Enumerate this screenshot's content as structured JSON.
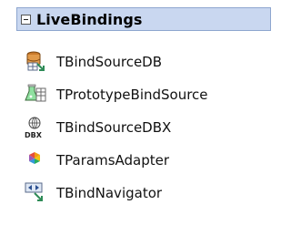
{
  "category": {
    "title": "LiveBindings",
    "state": "expanded"
  },
  "items": [
    {
      "label": "TBindSourceDB",
      "icon": "bind-source-db-icon"
    },
    {
      "label": "TPrototypeBindSource",
      "icon": "prototype-bind-source-icon"
    },
    {
      "label": "TBindSourceDBX",
      "icon": "bind-source-dbx-icon",
      "icon_text": "DBX"
    },
    {
      "label": "TParamsAdapter",
      "icon": "params-adapter-icon"
    },
    {
      "label": "TBindNavigator",
      "icon": "bind-navigator-icon"
    }
  ],
  "colors": {
    "header_bg": "#c9d7f0",
    "header_border": "#8ea6cf",
    "link_arrow": "#2e8b57"
  }
}
